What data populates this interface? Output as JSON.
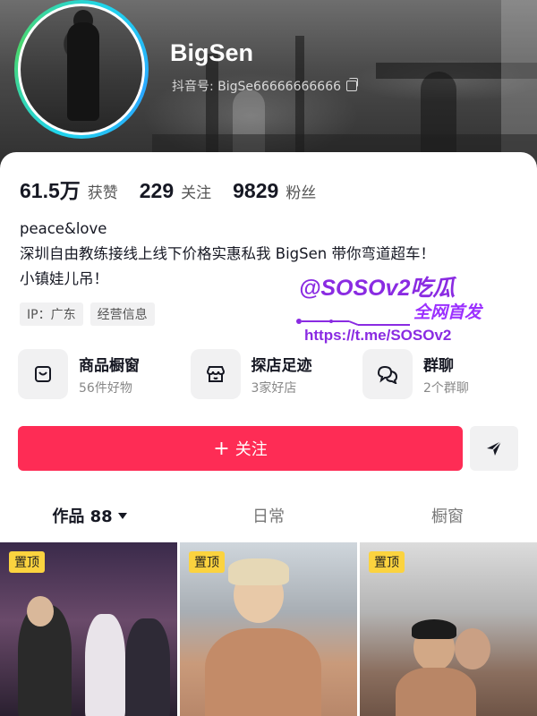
{
  "profile": {
    "username": "BigSen",
    "douyin_id": "抖音号: BigSe66666666666"
  },
  "stats": [
    {
      "num": "61.5万",
      "label": "获赞"
    },
    {
      "num": "229",
      "label": "关注"
    },
    {
      "num": "9829",
      "label": "粉丝"
    }
  ],
  "bio": {
    "line1": "peace&love",
    "line2": "深圳自由教练接线上线下价格实惠私我 BigSen 带你弯道超车！",
    "line3": "小镇娃儿吊！"
  },
  "tags": [
    "IP：广东",
    "经营信息"
  ],
  "watermark": {
    "title": "@SOSOv2吃瓜",
    "subtitle": "全网首发",
    "url": "https://t.me/SOSOv2"
  },
  "features": [
    {
      "title": "商品橱窗",
      "sub": "56件好物",
      "icon": "shopping-bag-icon"
    },
    {
      "title": "探店足迹",
      "sub": "3家好店",
      "icon": "store-icon"
    },
    {
      "title": "群聊",
      "sub": "2个群聊",
      "icon": "chat-bubbles-icon"
    }
  ],
  "actions": {
    "follow_label": "关注",
    "follow_plus": "+",
    "share_icon": "send-icon"
  },
  "tabs": [
    {
      "label": "作品 88",
      "active": true
    },
    {
      "label": "日常",
      "active": false
    },
    {
      "label": "橱窗",
      "active": false
    }
  ],
  "videos": [
    {
      "badge": "置顶"
    },
    {
      "badge": "置顶"
    },
    {
      "badge": "置顶"
    }
  ],
  "colors": {
    "accent": "#fe2c55",
    "pin_badge": "#fbd33f",
    "watermark": "#8a2be2"
  }
}
